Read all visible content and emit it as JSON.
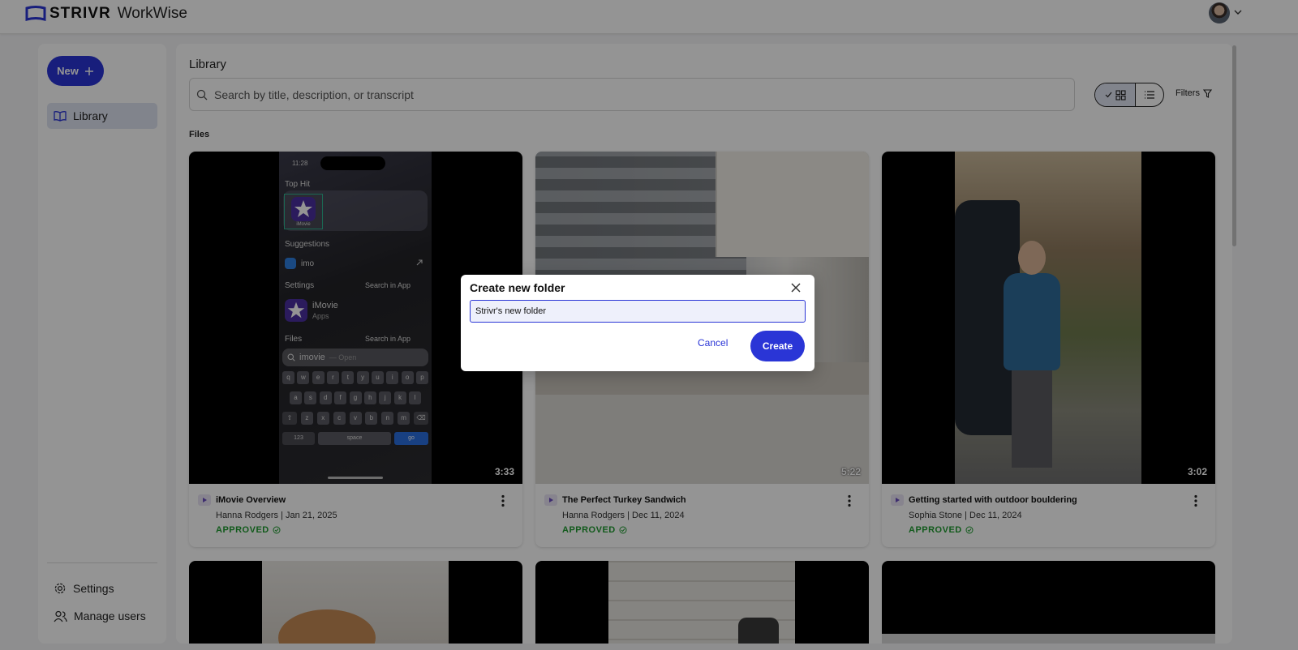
{
  "app": {
    "brand": "STRIVR",
    "product": "WorkWise"
  },
  "colors": {
    "accent": "#2a35d6",
    "approved": "#1e9b2f",
    "active_nav": "#dfe3f1"
  },
  "header": {
    "avatar_icon": "user-avatar",
    "menu_icon": "chevron-down-icon"
  },
  "sidebar": {
    "new_label": "New",
    "items": [
      {
        "label": "Library",
        "icon": "book-icon",
        "active": true
      }
    ],
    "bottom_items": [
      {
        "label": "Settings",
        "icon": "gear-icon"
      },
      {
        "label": "Manage users",
        "icon": "users-icon"
      }
    ]
  },
  "main": {
    "title": "Library",
    "search_placeholder": "Search by title, description, or transcript",
    "view_mode": "grid",
    "filters_label": "Filters",
    "section_label": "Files",
    "cards": [
      {
        "title": "iMovie Overview",
        "meta": "Hanna Rodgers | Jan 21, 2025",
        "status": "APPROVED",
        "duration": "3:33"
      },
      {
        "title": "The Perfect Turkey Sandwich",
        "meta": "Hanna Rodgers | Dec 11, 2024",
        "status": "APPROVED",
        "duration": "5:22"
      },
      {
        "title": "Getting started with outdoor bouldering",
        "meta": "Sophia Stone | Dec 11, 2024",
        "status": "APPROVED",
        "duration": "3:02"
      }
    ]
  },
  "phone_screen": {
    "time": "11:28",
    "top_hit": "Top Hit",
    "app_name": "iMovie",
    "suggestions": "Suggestions",
    "suggestion_query": "imo",
    "settings": "Settings",
    "search_in_app": "Search in App",
    "app_category": "Apps",
    "files": "Files",
    "search_text": "imovie",
    "search_hint": "— Open",
    "row1": [
      "q",
      "w",
      "e",
      "r",
      "t",
      "y",
      "u",
      "i",
      "o",
      "p"
    ],
    "row2": [
      "a",
      "s",
      "d",
      "f",
      "g",
      "h",
      "j",
      "k",
      "l"
    ],
    "row3": [
      "z",
      "x",
      "c",
      "v",
      "b",
      "n",
      "m"
    ],
    "key_123": "123",
    "key_space": "space",
    "key_go": "go"
  },
  "modal": {
    "title": "Create new folder",
    "input_value": "Strivr's new folder",
    "cancel_label": "Cancel",
    "create_label": "Create"
  }
}
